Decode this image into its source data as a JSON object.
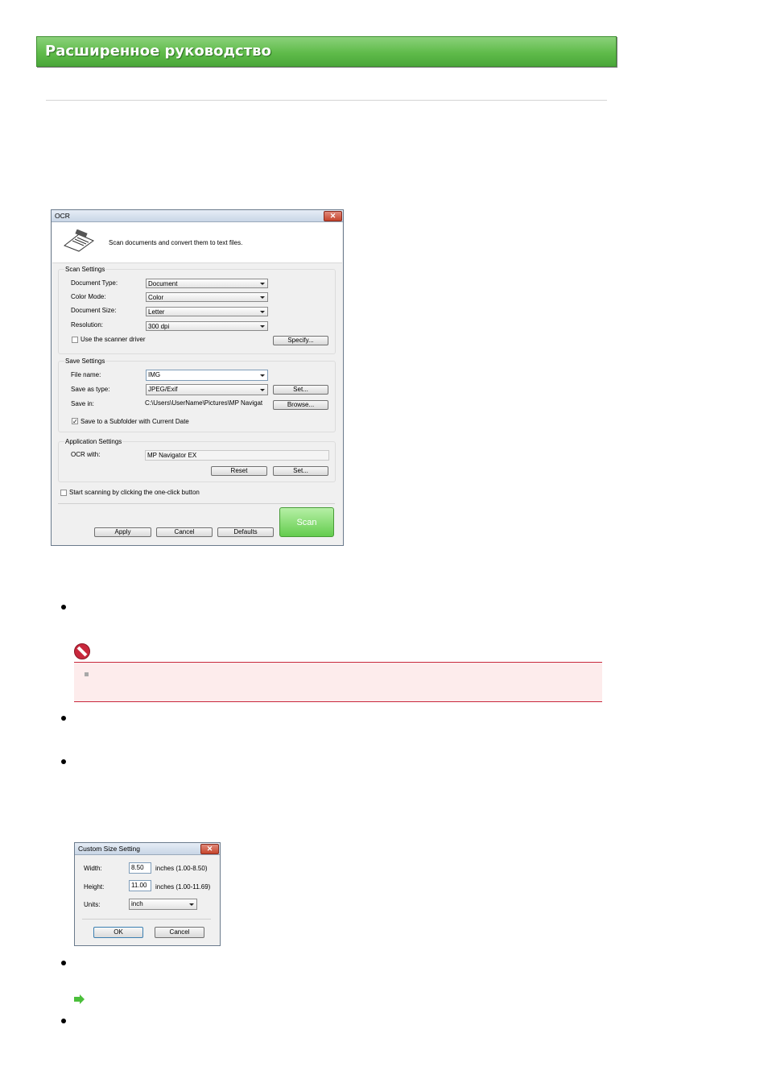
{
  "banner": {
    "title": "Расширенное руководство"
  },
  "ocr_dialog": {
    "title": "OCR",
    "description": "Scan documents and convert them to text files.",
    "scan_settings": {
      "heading": "Scan Settings",
      "document_type": {
        "label": "Document Type:",
        "value": "Document"
      },
      "color_mode": {
        "label": "Color Mode:",
        "value": "Color"
      },
      "document_size": {
        "label": "Document Size:",
        "value": "Letter"
      },
      "resolution": {
        "label": "Resolution:",
        "value": "300 dpi"
      },
      "use_scanner_driver": {
        "label": "Use the scanner driver",
        "checked": false
      },
      "specify_button": "Specify..."
    },
    "save_settings": {
      "heading": "Save Settings",
      "file_name": {
        "label": "File name:",
        "value": "IMG"
      },
      "save_as_type": {
        "label": "Save as type:",
        "value": "JPEG/Exif"
      },
      "set_button": "Set...",
      "save_in": {
        "label": "Save in:",
        "value": "C:\\Users\\UserName\\Pictures\\MP Navigat"
      },
      "browse_button": "Browse...",
      "subfolder": {
        "label": "Save to a Subfolder with Current Date",
        "checked": true
      }
    },
    "application_settings": {
      "heading": "Application Settings",
      "ocr_with": {
        "label": "OCR with:",
        "value": "MP Navigator EX"
      },
      "reset_button": "Reset",
      "set_button": "Set..."
    },
    "one_click": {
      "label": "Start scanning by clicking the one-click button",
      "checked": false
    },
    "buttons": {
      "apply": "Apply",
      "cancel": "Cancel",
      "defaults": "Defaults",
      "scan": "Scan"
    }
  },
  "custom_size_dialog": {
    "title": "Custom Size Setting",
    "width": {
      "label": "Width:",
      "value": "8.50",
      "range": "inches (1.00-8.50)"
    },
    "height": {
      "label": "Height:",
      "value": "11.00",
      "range": "inches (1.00-11.69)"
    },
    "units": {
      "label": "Units:",
      "value": "inch"
    },
    "ok": "OK",
    "cancel": "Cancel"
  },
  "colors": {
    "banner_green": "#5fbb4a",
    "warning_red": "#c8283c",
    "note_bg": "#fdecec",
    "link_green": "#4bbf3b"
  }
}
